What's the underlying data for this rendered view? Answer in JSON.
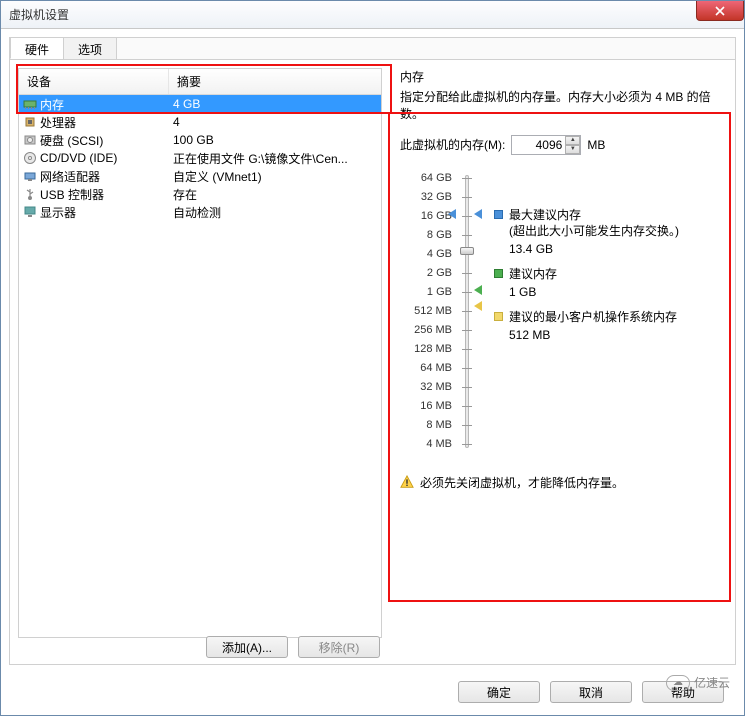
{
  "window": {
    "title": "虚拟机设置"
  },
  "tabs": {
    "hardware": "硬件",
    "options": "选项"
  },
  "hw_table": {
    "header_device": "设备",
    "header_summary": "摘要",
    "rows": [
      {
        "icon": "memory-icon",
        "name": "内存",
        "summary": "4 GB",
        "selected": true
      },
      {
        "icon": "cpu-icon",
        "name": "处理器",
        "summary": "4"
      },
      {
        "icon": "disk-icon",
        "name": "硬盘 (SCSI)",
        "summary": "100 GB"
      },
      {
        "icon": "cd-icon",
        "name": "CD/DVD (IDE)",
        "summary": "正在使用文件 G:\\镜像文件\\Cen..."
      },
      {
        "icon": "net-icon",
        "name": "网络适配器",
        "summary": "自定义 (VMnet1)"
      },
      {
        "icon": "usb-icon",
        "name": "USB 控制器",
        "summary": "存在"
      },
      {
        "icon": "display-icon",
        "name": "显示器",
        "summary": "自动检测"
      }
    ]
  },
  "buttons": {
    "add": "添加(A)...",
    "remove": "移除(R)",
    "ok": "确定",
    "cancel": "取消",
    "help": "帮助"
  },
  "memory": {
    "section_title": "内存",
    "desc": "指定分配给此虚拟机的内存量。内存大小必须为 4 MB 的倍数。",
    "field_label": "此虚拟机的内存(M):",
    "value": "4096",
    "unit": "MB",
    "ticks": [
      "64 GB",
      "32 GB",
      "16 GB",
      "8 GB",
      "4 GB",
      "2 GB",
      "1 GB",
      "512 MB",
      "256 MB",
      "128 MB",
      "64 MB",
      "32 MB",
      "16 MB",
      "8 MB",
      "4 MB"
    ],
    "legend": {
      "max_label": "最大建议内存",
      "max_note": "(超出此大小可能发生内存交换。)",
      "max_val": "13.4 GB",
      "rec_label": "建议内存",
      "rec_val": "1 GB",
      "min_label": "建议的最小客户机操作系统内存",
      "min_val": "512 MB"
    },
    "warning": "必须先关闭虚拟机，才能降低内存量。"
  },
  "watermark": "亿速云"
}
